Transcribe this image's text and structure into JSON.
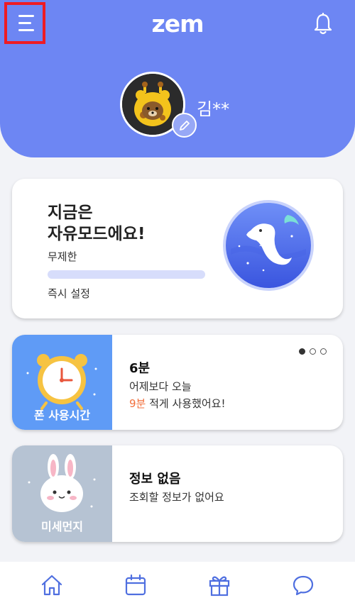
{
  "header": {
    "logo_text": "zem",
    "user_name": "김**"
  },
  "mode_card": {
    "title_line1": "지금은",
    "title_line2": "자유모드에요!",
    "limit_text": "무제한",
    "setting_link": "즉시 설정"
  },
  "usage_card": {
    "tile_label": "폰 사용시간",
    "value": "6분",
    "compare_line": "어제보다 오늘",
    "diff_value": "9분",
    "diff_suffix": " 적게 사용했어요!",
    "page_indicator": {
      "current": 1,
      "total": 3
    }
  },
  "dust_card": {
    "tile_label": "미세먼지",
    "title": "정보 없음",
    "subtitle": "조회할 정보가 없어요"
  },
  "bottom_nav": {
    "items": [
      "home-icon",
      "calendar-icon",
      "gift-icon",
      "chat-icon"
    ]
  },
  "colors": {
    "header_bg": "#6d86f3",
    "usage_tile": "#5f9bf6",
    "dust_tile": "#b6c3d3",
    "accent": "#f26f3c",
    "highlight_box": "#ee1b24",
    "nav_icon": "#4f6fe0"
  }
}
